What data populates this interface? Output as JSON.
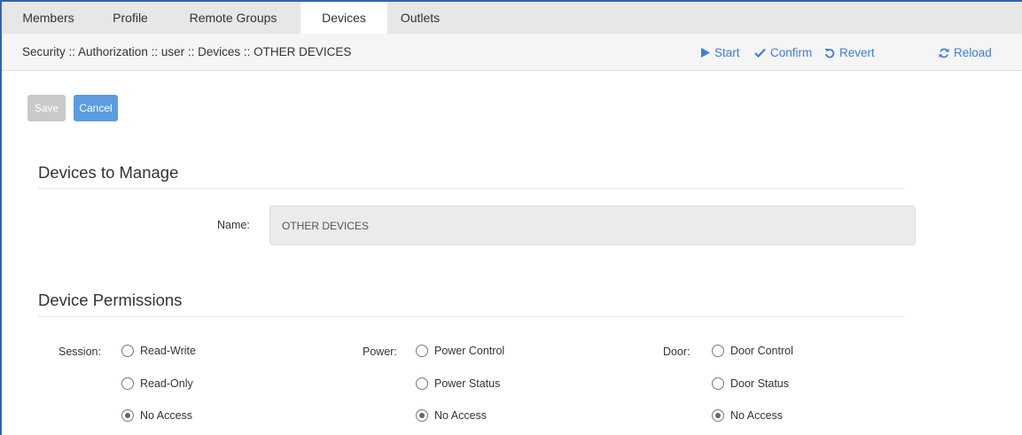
{
  "tabs": [
    {
      "label": "Members"
    },
    {
      "label": "Profile"
    },
    {
      "label": "Remote Groups"
    },
    {
      "label": "Devices",
      "active": true
    },
    {
      "label": "Outlets"
    }
  ],
  "breadcrumb": "Security :: Authorization :: user :: Devices :: OTHER DEVICES",
  "actions": {
    "start": "Start",
    "confirm": "Confirm",
    "revert": "Revert",
    "reload": "Reload"
  },
  "buttons": {
    "save": "Save",
    "cancel": "Cancel"
  },
  "devices_section": {
    "title": "Devices to Manage",
    "name_label": "Name:",
    "name_value": "OTHER DEVICES"
  },
  "permissions_section": {
    "title": "Device Permissions",
    "session": {
      "label": "Session:",
      "options": [
        "Read-Write",
        "Read-Only",
        "No Access"
      ],
      "selected": "No Access"
    },
    "power": {
      "label": "Power:",
      "options": [
        "Power Control",
        "Power Status",
        "No Access"
      ],
      "selected": "No Access"
    },
    "door": {
      "label": "Door:",
      "options": [
        "Door Control",
        "Door Status",
        "No Access"
      ],
      "selected": "No Access"
    }
  },
  "colors": {
    "accent": "#3b7fd6",
    "frame": "#2e63b8",
    "cancel_button": "#5b9de0",
    "save_button_disabled": "#c9c9c9"
  }
}
